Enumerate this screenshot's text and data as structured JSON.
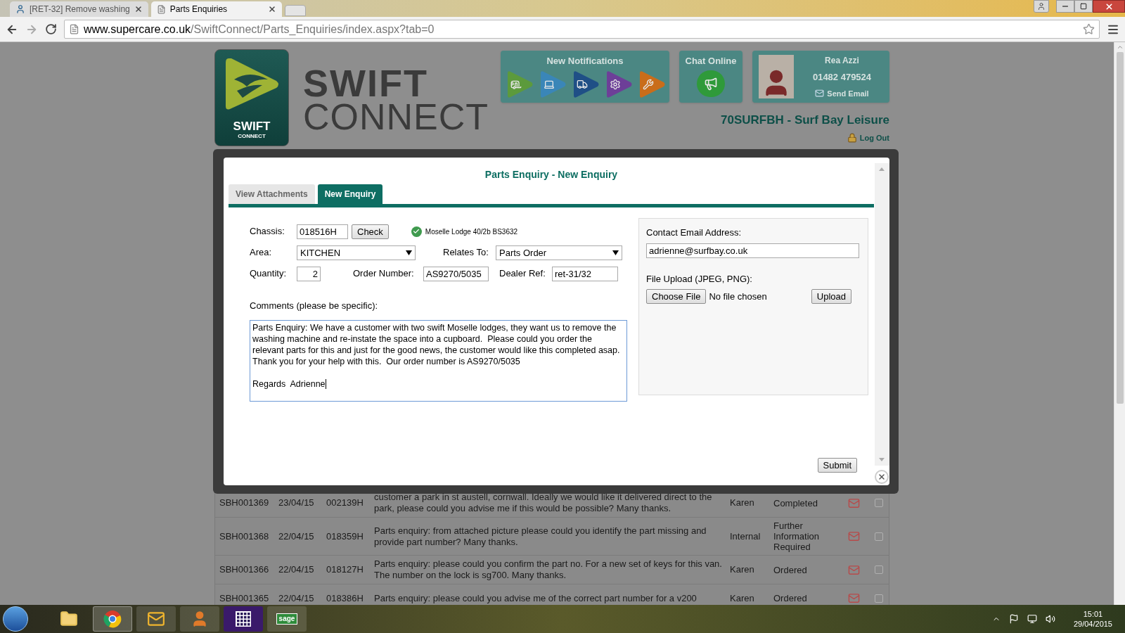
{
  "browser": {
    "tabs": [
      {
        "title": "[RET-32] Remove washing",
        "selected": false,
        "kind": "tracker"
      },
      {
        "title": "Parts Enquiries",
        "selected": true,
        "kind": "page"
      }
    ],
    "address": {
      "host": "www.supercare.co.uk",
      "path": "/SwiftConnect/Parts_Enquiries/index.aspx?tab=0"
    }
  },
  "header": {
    "wordmark_top": "SWIFT",
    "wordmark_bottom": "CONNECT",
    "badge_top": "SWIFT",
    "badge_bottom": "CONNECT",
    "notifications": {
      "title": "New Notifications",
      "items": [
        {
          "kind": "caravan",
          "color": "#5c9a3c"
        },
        {
          "kind": "laptop",
          "color": "#3a86b8"
        },
        {
          "kind": "truck",
          "color": "#1f4f86"
        },
        {
          "kind": "gear",
          "color": "#6d3f98"
        },
        {
          "kind": "tools",
          "color": "#c96d1a"
        }
      ]
    },
    "chat": {
      "title": "Chat Online"
    },
    "user": {
      "name": "Rea Azzi",
      "phone": "01482 479524",
      "send_email": "Send Email"
    },
    "dealer": "70SURFBH - Surf Bay Leisure",
    "logout": "Log Out"
  },
  "modal": {
    "title": "Parts Enquiry - New Enquiry",
    "tabs": [
      {
        "label": "View Attachments",
        "selected": false
      },
      {
        "label": "New Enquiry",
        "selected": true
      }
    ],
    "chassis": {
      "label": "Chassis:",
      "value": "018516H",
      "button": "Check",
      "verified": true,
      "result": "Moselle Lodge 40/2b BS3632"
    },
    "area": {
      "label": "Area:",
      "value": "KITCHEN"
    },
    "relates_to": {
      "label": "Relates To:",
      "value": "Parts Order"
    },
    "quantity": {
      "label": "Quantity:",
      "value": "2"
    },
    "order_number": {
      "label": "Order Number:",
      "value": "AS9270/5035"
    },
    "dealer_ref": {
      "label": "Dealer Ref:",
      "value": "ret-31/32"
    },
    "comments": {
      "label": "Comments (please be specific):",
      "value": "Parts Enquiry: We have a customer with two swift Moselle lodges, they want us to remove the washing machine and re-instate the space into a cupboard.  Please could you order the relevant parts for this and just for the good news, the customer would like this completed asap. Thank you for your help with this.  Our order number is AS9270/5035\n\nRegards  Adrienne"
    },
    "contact": {
      "label": "Contact Email Address:",
      "value": "adrienne@surfbay.co.uk"
    },
    "upload": {
      "label": "File Upload (JPEG, PNG):",
      "choose": "Choose File",
      "status": "No file chosen",
      "button": "Upload"
    },
    "submit": "Submit"
  },
  "table": {
    "rows": [
      {
        "id": "SBH001369",
        "date": "23/04/15",
        "chassis": "002139H",
        "description": "customer a park in st austell, cornwall. Ideally we would like it delivered direct to the park, please could you advise me if this would be possible? Many thanks.",
        "assigned": "Karen",
        "status": "Completed",
        "checked": false
      },
      {
        "id": "SBH001368",
        "date": "22/04/15",
        "chassis": "018359H",
        "description": "Parts enquiry: from attached picture please could you identify the part missing and provide part number? Many thanks.",
        "assigned": "Internal",
        "status": "Further Information Required",
        "checked": false
      },
      {
        "id": "SBH001366",
        "date": "22/04/15",
        "chassis": "018127H",
        "description": "Parts enquiry: please could you confirm the part no. For a new set of keys for this van. The number on the lock is sg700. Many thanks.",
        "assigned": "Karen",
        "status": "Ordered",
        "checked": false
      },
      {
        "id": "SBH001365",
        "date": "22/04/15",
        "chassis": "018386H",
        "description": "Parts enquiry: please could you advise me of the correct part number for a v200",
        "assigned": "Karen",
        "status": "Ordered",
        "checked": false
      }
    ]
  },
  "taskbar": {
    "apps": [
      {
        "kind": "folder"
      },
      {
        "kind": "browser"
      },
      {
        "kind": "mail"
      },
      {
        "kind": "contacts"
      },
      {
        "kind": "calendar"
      },
      {
        "kind": "sage",
        "label": "sage"
      }
    ],
    "time": "15:01",
    "date": "29/04/2015"
  }
}
